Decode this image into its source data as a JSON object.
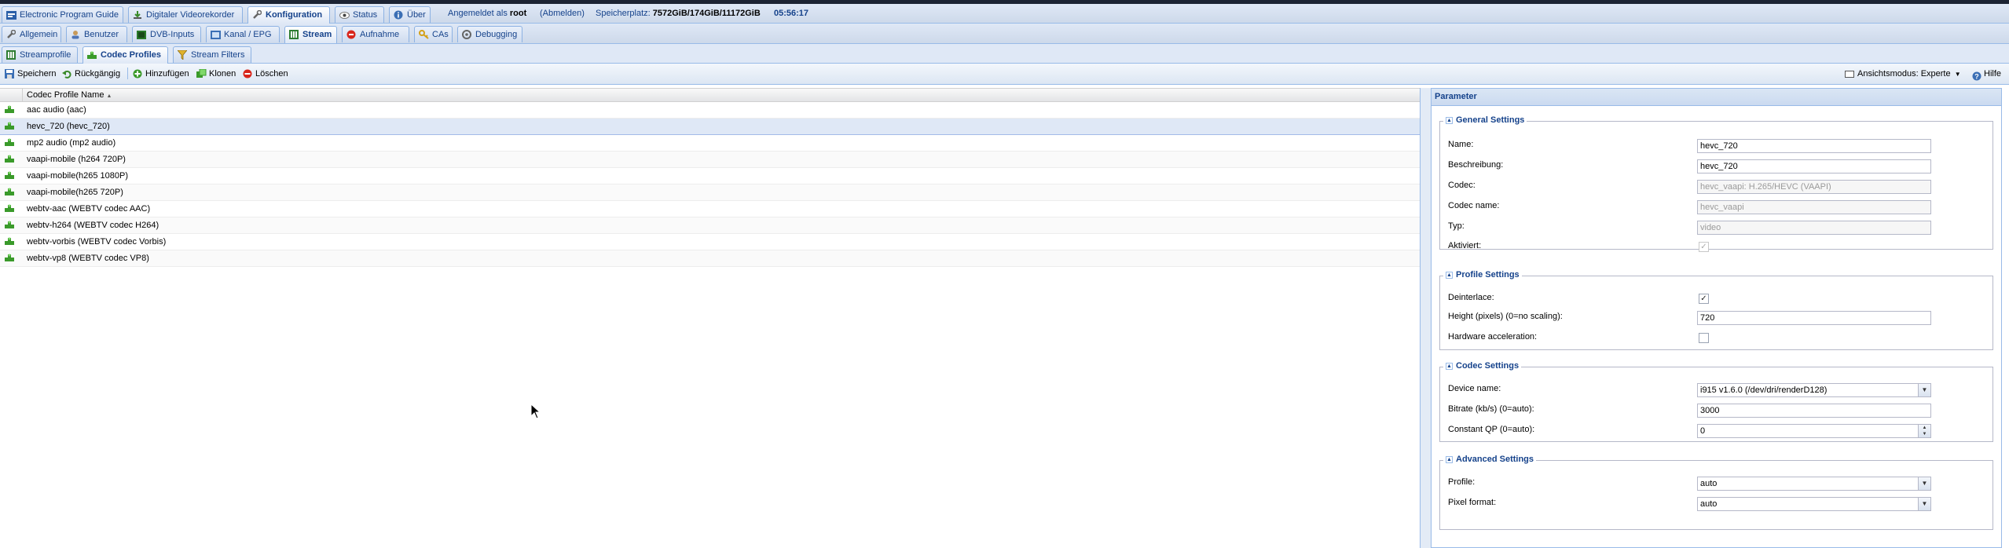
{
  "top_tabs": [
    {
      "label": "Electronic Program Guide",
      "icon": "epg-icon"
    },
    {
      "label": "Digitaler Videorekorder",
      "icon": "dvr-icon"
    },
    {
      "label": "Konfiguration",
      "icon": "wrench-icon"
    },
    {
      "label": "Status",
      "icon": "eye-icon"
    },
    {
      "label": "Über",
      "icon": "info-icon"
    }
  ],
  "login": {
    "prefix": "Angemeldet als",
    "user": "root",
    "logout": "(Abmelden)"
  },
  "storage": {
    "label": "Speicherplatz:",
    "value": "7572GiB/174GiB/11172GiB"
  },
  "clock": "05:56:17",
  "config_tabs": [
    {
      "label": "Allgemein",
      "icon": "general-icon"
    },
    {
      "label": "Benutzer",
      "icon": "users-icon"
    },
    {
      "label": "DVB-Inputs",
      "icon": "dvb-icon"
    },
    {
      "label": "Kanal / EPG",
      "icon": "channel-icon"
    },
    {
      "label": "Stream",
      "icon": "stream-icon"
    },
    {
      "label": "Aufnahme",
      "icon": "record-icon"
    },
    {
      "label": "CAs",
      "icon": "key-icon"
    },
    {
      "label": "Debugging",
      "icon": "debug-icon"
    }
  ],
  "stream_tabs": [
    {
      "label": "Streamprofile",
      "icon": "profile-icon"
    },
    {
      "label": "Codec Profiles",
      "icon": "codec-icon"
    },
    {
      "label": "Stream Filters",
      "icon": "filter-icon"
    }
  ],
  "toolbar": {
    "save": "Speichern",
    "undo": "Rückgängig",
    "add": "Hinzufügen",
    "clone": "Klonen",
    "delete": "Löschen",
    "view_mode": "Ansichtsmodus: Experte",
    "help": "Hilfe"
  },
  "grid": {
    "column": "Codec Profile Name",
    "rows": [
      "aac audio (aac)",
      "hevc_720 (hevc_720)",
      "mp2 audio (mp2 audio)",
      "vaapi-mobile (h264 720P)",
      "vaapi-mobile(h265 1080P)",
      "vaapi-mobile(h265 720P)",
      "webtv-aac (WEBTV codec AAC)",
      "webtv-h264 (WEBTV codec H264)",
      "webtv-vorbis (WEBTV codec Vorbis)",
      "webtv-vp8 (WEBTV codec VP8)"
    ],
    "selected_index": 1
  },
  "panel": {
    "title": "Parameter",
    "general": {
      "legend": "General Settings",
      "name_label": "Name:",
      "name_value": "hevc_720",
      "desc_label": "Beschreibung:",
      "desc_value": "hevc_720",
      "codec_label": "Codec:",
      "codec_value": "hevc_vaapi: H.265/HEVC (VAAPI)",
      "codec_name_label": "Codec name:",
      "codec_name_value": "hevc_vaapi",
      "type_label": "Typ:",
      "type_value": "video",
      "enabled_label": "Aktiviert:",
      "enabled": true
    },
    "profile": {
      "legend": "Profile Settings",
      "deinterlace_label": "Deinterlace:",
      "deinterlace": true,
      "height_label": "Height (pixels) (0=no scaling):",
      "height_value": "720",
      "hwaccel_label": "Hardware acceleration:",
      "hwaccel": false
    },
    "codec": {
      "legend": "Codec Settings",
      "device_label": "Device name:",
      "device_value": "i915 v1.6.0 (/dev/dri/renderD128)",
      "bitrate_label": "Bitrate (kb/s) (0=auto):",
      "bitrate_value": "3000",
      "qp_label": "Constant QP (0=auto):",
      "qp_value": "0"
    },
    "advanced": {
      "legend": "Advanced Settings",
      "profile_label": "Profile:",
      "profile_value": "auto",
      "pixfmt_label": "Pixel format:",
      "pixfmt_value": "auto"
    }
  }
}
